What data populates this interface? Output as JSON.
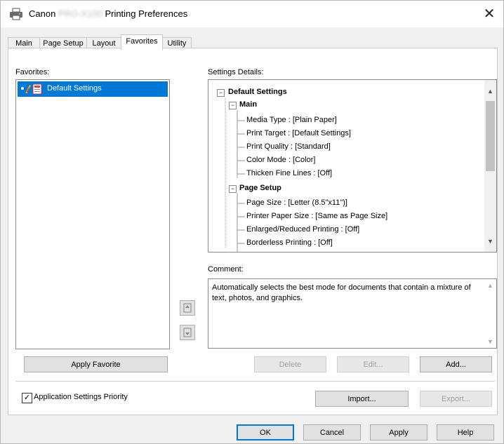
{
  "window": {
    "title_prefix": "Canon",
    "title_model": "PRO-X100",
    "title_suffix": "Printing Preferences",
    "close_label": "✕"
  },
  "tabs": [
    {
      "label": "Main"
    },
    {
      "label": "Page Setup"
    },
    {
      "label": "Layout"
    },
    {
      "label": "Favorites",
      "active": true
    },
    {
      "label": "Utility"
    }
  ],
  "favorites": {
    "label": "Favorites:",
    "items": [
      {
        "label": "Default Settings",
        "selected": true
      }
    ],
    "apply_button": "Apply Favorite"
  },
  "details": {
    "label": "Settings Details:",
    "tree": [
      {
        "text": "Default Settings",
        "level": 0,
        "bold": true,
        "expander": "−"
      },
      {
        "text": "Main",
        "level": 1,
        "bold": true,
        "expander": "−"
      },
      {
        "text": "Media Type : [Plain Paper]",
        "level": 2
      },
      {
        "text": "Print Target : [Default Settings]",
        "level": 2
      },
      {
        "text": "Print Quality : [Standard]",
        "level": 2
      },
      {
        "text": "Color Mode : [Color]",
        "level": 2
      },
      {
        "text": "Thicken Fine Lines : [Off]",
        "level": 2
      },
      {
        "text": "Page Setup",
        "level": 1,
        "bold": true,
        "expander": "−"
      },
      {
        "text": "Page Size : [Letter (8.5\"x11\")]",
        "level": 2
      },
      {
        "text": "Printer Paper Size : [Same as Page Size]",
        "level": 2
      },
      {
        "text": "Enlarged/Reduced Printing : [Off]",
        "level": 2
      },
      {
        "text": "Borderless Printing : [Off]",
        "level": 2
      }
    ]
  },
  "comment": {
    "label": "Comment:",
    "text": "Automatically selects the best mode for documents that contain a mixture of text, photos, and graphics."
  },
  "actions": {
    "delete": "Delete",
    "edit": "Edit...",
    "add": "Add...",
    "import": "Import...",
    "export": "Export..."
  },
  "priority": {
    "label": "Application Settings Priority",
    "checked": true
  },
  "dialog": {
    "ok": "OK",
    "cancel": "Cancel",
    "apply": "Apply",
    "help": "Help"
  },
  "colors": {
    "selection": "#0078d7",
    "disabled_text": "#a0a0a0"
  }
}
